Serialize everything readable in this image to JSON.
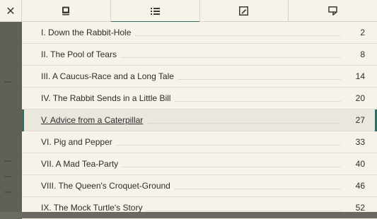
{
  "toolbar": {
    "close_icon": "close-icon",
    "tabs": [
      {
        "name": "book-icon",
        "active": false
      },
      {
        "name": "toc-list-icon",
        "active": true
      },
      {
        "name": "notes-icon",
        "active": false
      },
      {
        "name": "bookmark-icon",
        "active": false
      }
    ]
  },
  "toc": {
    "items": [
      {
        "title": "I. Down the Rabbit-Hole",
        "page": "2"
      },
      {
        "title": "II. The Pool of Tears",
        "page": "8"
      },
      {
        "title": "III. A Caucus-Race and a Long Tale",
        "page": "14"
      },
      {
        "title": "IV. The Rabbit Sends in a Little Bill",
        "page": "20"
      },
      {
        "title": "V. Advice from a Caterpillar",
        "page": "27"
      },
      {
        "title": "VI. Pig and Pepper",
        "page": "33"
      },
      {
        "title": "VII. A Mad Tea-Party",
        "page": "40"
      },
      {
        "title": "VIII. The Queen's Croquet-Ground",
        "page": "46"
      },
      {
        "title": "IX. The Mock Turtle's Story",
        "page": "52"
      }
    ],
    "active_index": 4
  },
  "colors": {
    "accent": "#2f6f65",
    "panel": "#f6f3ea",
    "overlay": "#605f58"
  }
}
